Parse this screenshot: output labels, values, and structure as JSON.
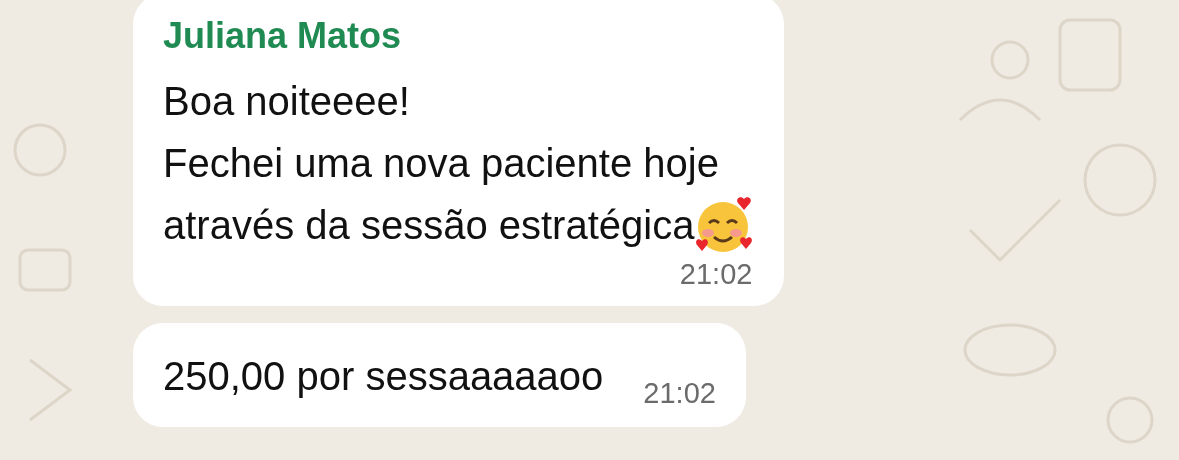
{
  "messages": [
    {
      "kind": "text",
      "sender": "Juliana Matos",
      "lines": [
        "Boa noiteeee!",
        "Fechei uma nova paciente hoje",
        "através da sessão estratégica"
      ],
      "emoji": true,
      "time": "21:02"
    },
    {
      "kind": "inline",
      "lines": [
        "250,00 por sessaaaaaoo"
      ],
      "time": "21:02"
    }
  ]
}
